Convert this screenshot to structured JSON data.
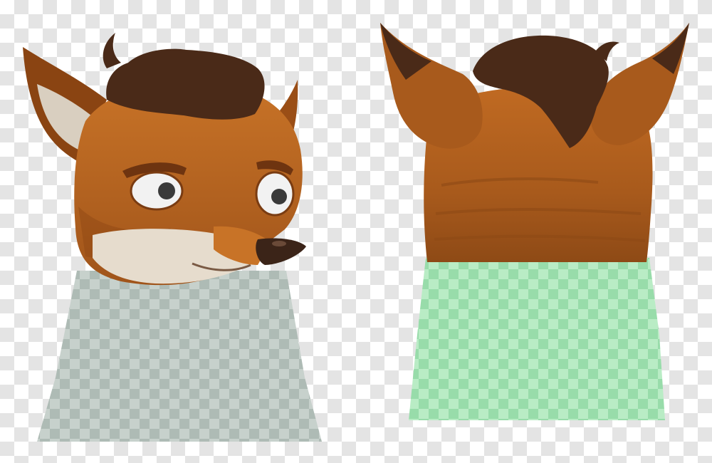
{
  "image": {
    "content": "two-fox-character-heads",
    "views": [
      "front-view",
      "back-view"
    ]
  },
  "colors": {
    "fur_orange": "#b8641e",
    "fur_dark_orange": "#8a4412",
    "fur_light": "#d98a3a",
    "hair_dark_brown": "#4a2a18",
    "ear_inner": "#d9cfc0",
    "muzzle_white": "#e6dccd",
    "eye_white": "#f2f2f2",
    "nose": "#3b2418",
    "neck_gray": "#a9b7b0",
    "neck_green": "#8fd3a0"
  }
}
